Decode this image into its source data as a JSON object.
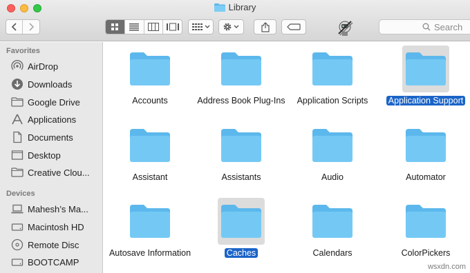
{
  "window": {
    "title": "Library",
    "search_placeholder": "Search"
  },
  "toolbar": {
    "back_icon": "chevron-left-icon",
    "forward_icon": "chevron-right-icon",
    "view_modes": [
      "icon-view",
      "list-view",
      "column-view",
      "gallery-view"
    ],
    "active_view": "icon-view"
  },
  "sidebar": {
    "favorites_header": "Favorites",
    "favorites": [
      {
        "label": "AirDrop",
        "icon": "airdrop-icon"
      },
      {
        "label": "Downloads",
        "icon": "downloads-icon"
      },
      {
        "label": "Google Drive",
        "icon": "folder-icon"
      },
      {
        "label": "Applications",
        "icon": "applications-icon"
      },
      {
        "label": "Documents",
        "icon": "document-icon"
      },
      {
        "label": "Desktop",
        "icon": "desktop-icon"
      },
      {
        "label": "Creative Clou...",
        "icon": "folder-icon"
      }
    ],
    "devices_header": "Devices",
    "devices": [
      {
        "label": "Mahesh’s Ma...",
        "icon": "laptop-icon"
      },
      {
        "label": "Macintosh HD",
        "icon": "harddisk-icon"
      },
      {
        "label": "Remote Disc",
        "icon": "disc-icon"
      },
      {
        "label": "BOOTCAMP",
        "icon": "harddisk-icon"
      }
    ]
  },
  "folders": [
    {
      "name": "Accounts",
      "selected": false
    },
    {
      "name": "Address Book Plug-Ins",
      "selected": false
    },
    {
      "name": "Application Scripts",
      "selected": false
    },
    {
      "name": "Application Support",
      "selected": true
    },
    {
      "name": "Assistant",
      "selected": false
    },
    {
      "name": "Assistants",
      "selected": false
    },
    {
      "name": "Audio",
      "selected": false
    },
    {
      "name": "Automator",
      "selected": false
    },
    {
      "name": "Autosave Information",
      "selected": false
    },
    {
      "name": "Caches",
      "selected": true
    },
    {
      "name": "Calendars",
      "selected": false
    },
    {
      "name": "ColorPickers",
      "selected": false
    }
  ],
  "watermark": "wsxdn.com",
  "colors": {
    "folder": "#6cc4f2",
    "selection": "#1a64c8",
    "sidebar_bg": "#e8e8e8"
  }
}
